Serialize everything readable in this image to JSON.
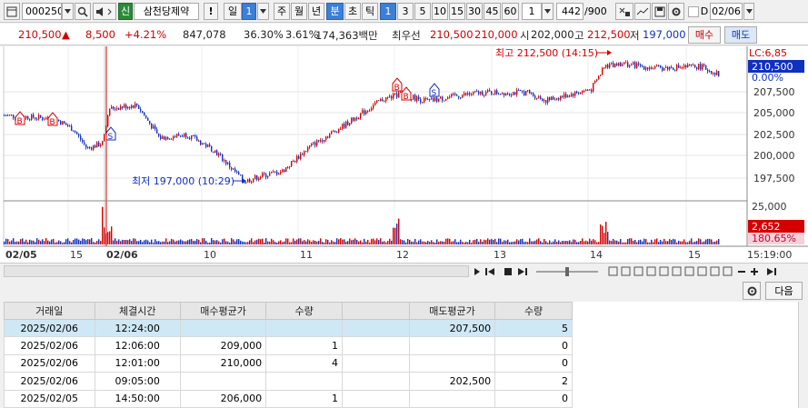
{
  "toolbar": {
    "code": "000250",
    "badge": "신",
    "stock_name": "삼천당제약",
    "bang": "!",
    "period_day": "일",
    "period_day_num": "1",
    "week": "주",
    "month": "월",
    "year": "년",
    "minute": "분",
    "second": "초",
    "tick": "틱",
    "intervals": [
      "1",
      "3",
      "5",
      "10",
      "15",
      "30",
      "45",
      "60"
    ],
    "interval_select": "1",
    "count": "442",
    "count_total": "/900",
    "date": "02/06",
    "check_label": "D"
  },
  "quote": {
    "price": "210,500",
    "change": "8,500",
    "change_pct": "+4.21%",
    "volume": "847,078",
    "ratio": "36.30%",
    "ratio2": "3.61%",
    "amount": "174,363백만",
    "best_label": "최우선",
    "best_ask": "210,500",
    "best_bid": "210,000",
    "open_label": "시",
    "open": "202,000",
    "high_label": "고",
    "high": "212,500",
    "low_label": "저",
    "low": "197,000",
    "buy_btn": "매수",
    "sell_btn": "매도"
  },
  "chart": {
    "high_annot": "최고 212,500 (14:15)",
    "low_annot": "최저 197,000 (10:29)",
    "lc_label": "LC:6,85",
    "price_tag": "210,500",
    "pct_tag": "0.00%",
    "y_ticks": [
      "207,500",
      "205,000",
      "202,500",
      "200,000",
      "197,500"
    ],
    "vol_tick": "25,000",
    "vol_tag": "2,652",
    "vol_pct_tag": "180.65%",
    "x_labels": [
      {
        "t": "02/05",
        "bold": true
      },
      {
        "t": "15",
        "bold": false
      },
      {
        "t": "02/06",
        "bold": true
      },
      {
        "t": "10",
        "bold": false
      },
      {
        "t": "11",
        "bold": false
      },
      {
        "t": "12",
        "bold": false
      },
      {
        "t": "13",
        "bold": false
      },
      {
        "t": "14",
        "bold": false
      },
      {
        "t": "15",
        "bold": false
      }
    ],
    "time_label": "15:19:00",
    "sell_marker": "S",
    "buy_marker": "B"
  },
  "grid": {
    "next_btn": "다음",
    "headers": [
      "거래일",
      "체결시간",
      "매수평균가",
      "수량",
      "",
      "매도평균가",
      "수량"
    ],
    "rows": [
      [
        "2025/02/06",
        "12:24:00",
        "",
        "",
        "",
        "207,500",
        "5"
      ],
      [
        "2025/02/06",
        "12:06:00",
        "209,000",
        "1",
        "",
        "",
        "0"
      ],
      [
        "2025/02/06",
        "12:01:00",
        "210,000",
        "4",
        "",
        "",
        "0"
      ],
      [
        "2025/02/06",
        "09:05:00",
        "",
        "",
        "",
        "202,500",
        "2"
      ],
      [
        "2025/02/05",
        "14:50:00",
        "206,000",
        "1",
        "",
        "",
        "0"
      ]
    ]
  },
  "chart_data": {
    "type": "candlestick",
    "x": [
      "02/05",
      "15",
      "02/06",
      "10",
      "11",
      "12",
      "13",
      "14",
      "15"
    ],
    "ylim": [
      196000,
      213500
    ],
    "high": 212500,
    "low": 197000,
    "last": 210500
  }
}
